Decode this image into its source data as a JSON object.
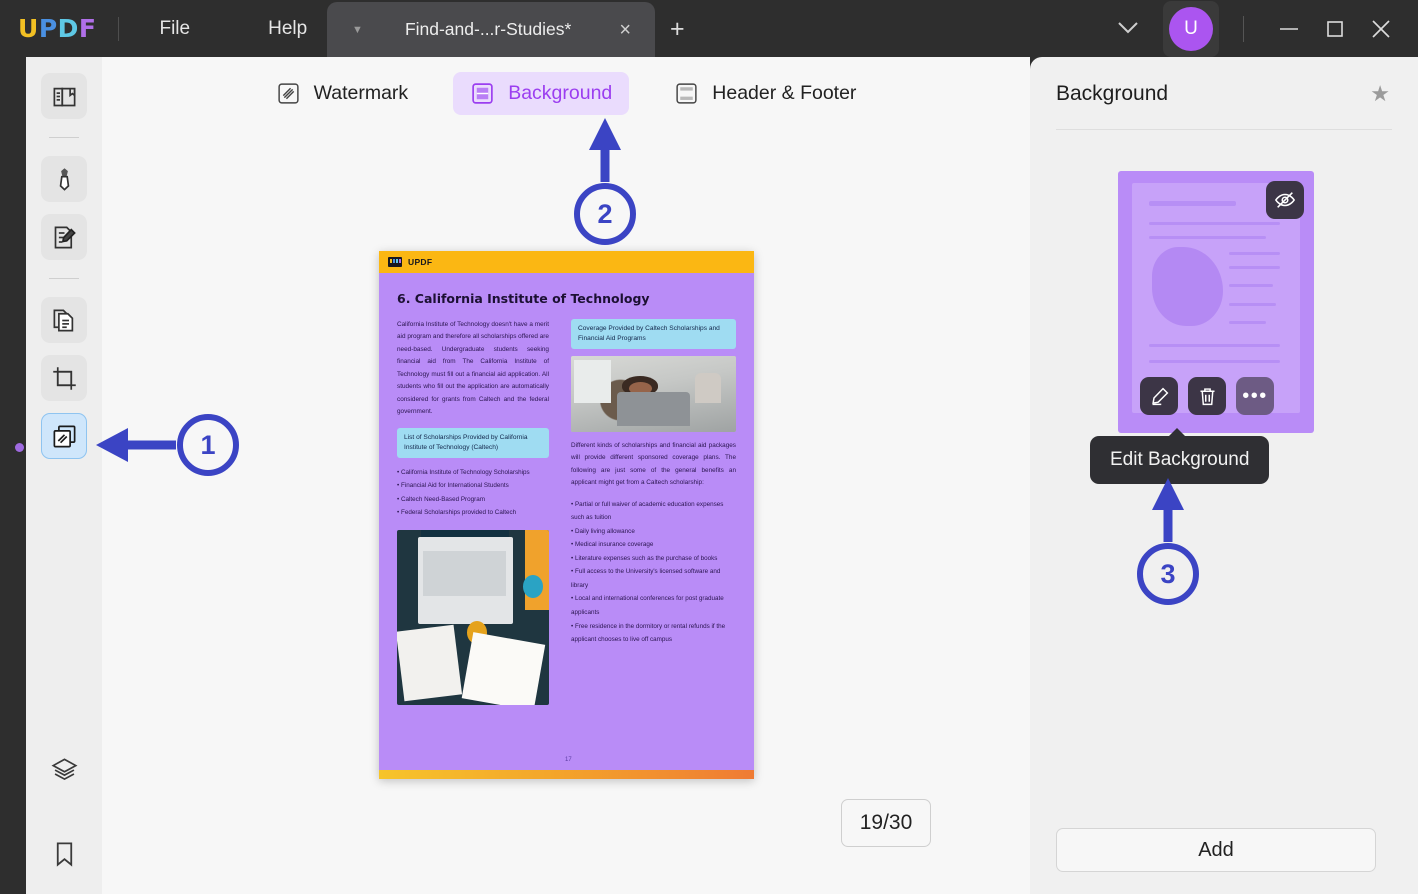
{
  "window": {
    "logo": "UPDF",
    "logo_letters": [
      "U",
      "P",
      "D",
      "F"
    ],
    "menus": [
      "File",
      "Help"
    ],
    "tab_title": "Find-and-...r-Studies*",
    "tab_close_label": "×",
    "new_tab_label": "+",
    "avatar_initial": "U",
    "controls": {
      "minimize": "—",
      "maximize": "□",
      "close": "×",
      "expand": "⌄"
    }
  },
  "left_rail": {
    "tools": [
      {
        "name": "reader",
        "label": "Reader"
      },
      {
        "name": "comment",
        "label": "Comment"
      },
      {
        "name": "edit-pdf",
        "label": "Edit PDF"
      },
      {
        "name": "organize-pages",
        "label": "Organize Pages"
      },
      {
        "name": "crop",
        "label": "Crop"
      },
      {
        "name": "page-tools",
        "label": "Page Tools",
        "active": true
      }
    ],
    "bottom_tools": [
      {
        "name": "layers",
        "label": "Layers"
      },
      {
        "name": "bookmark",
        "label": "Bookmark"
      }
    ]
  },
  "subtoolbar": {
    "items": [
      {
        "label": "Watermark",
        "icon": "watermark-icon",
        "active": false
      },
      {
        "label": "Background",
        "icon": "background-icon",
        "active": true
      },
      {
        "label": "Header & Footer",
        "icon": "header-footer-icon",
        "active": false
      }
    ]
  },
  "document": {
    "brand_band": "UPDF",
    "heading": "6. California Institute of Technology",
    "left_paragraph": "California Institute of Technology doesn't have a merit aid program and therefore all scholarships offered are need-based. Undergraduate students seeking financial aid from The California Institute of Technology must fill out a financial aid application. All students who fill out the application are automatically considered for grants from Caltech and the federal government.",
    "left_caption": "List of Scholarships Provided by California Institute of Technology (Caltech)",
    "left_bullets": [
      "California Institute of Technology Scholarships",
      "Financial Aid for International Students",
      "Caltech Need-Based Program",
      "Federal Scholarships provided to Caltech"
    ],
    "right_caption": "Coverage Provided by Caltech Scholarships and Financial Aid Programs",
    "right_paragraph": "Different kinds of scholarships and financial aid packages will provide different sponsored coverage plans. The following are just some of the general benefits an applicant might get from a Caltech scholarship:",
    "right_bullets": [
      "Partial or full waiver of academic education expenses such as tuition",
      "Daily living allowance",
      "Medical insurance coverage",
      "Literature expenses such as the purchase of books",
      "Full access to the University's licensed software and library",
      "Local and international conferences for post graduate applicants",
      "Free residence in the dormitory or rental refunds if the applicant chooses to live off campus"
    ],
    "page_number": "17"
  },
  "page_counter": "19/30",
  "right_panel": {
    "title": "Background",
    "star_icon": "★",
    "card": {
      "hide_icon": "eye-slash-icon",
      "actions": [
        {
          "name": "edit-background-button",
          "icon": "pencil-icon"
        },
        {
          "name": "delete-background-button",
          "icon": "trash-icon"
        },
        {
          "name": "more-options-button",
          "icon": "ellipsis-icon",
          "label": "•••"
        }
      ]
    },
    "tooltip": "Edit Background",
    "add_label": "Add"
  },
  "annotations": {
    "color": "#3b44c4",
    "markers": [
      {
        "id": "1",
        "target": "page-tools-rail-icon"
      },
      {
        "id": "2",
        "target": "background-subtoolbar-button"
      },
      {
        "id": "3",
        "target": "edit-background-tooltip"
      }
    ]
  },
  "colors": {
    "accent_purple": "#9b3ef0",
    "doc_purple": "#b98cf7",
    "band_yellow": "#fbb713",
    "annotation_blue": "#3b44c4",
    "avatar_purple": "#ab55f0"
  }
}
